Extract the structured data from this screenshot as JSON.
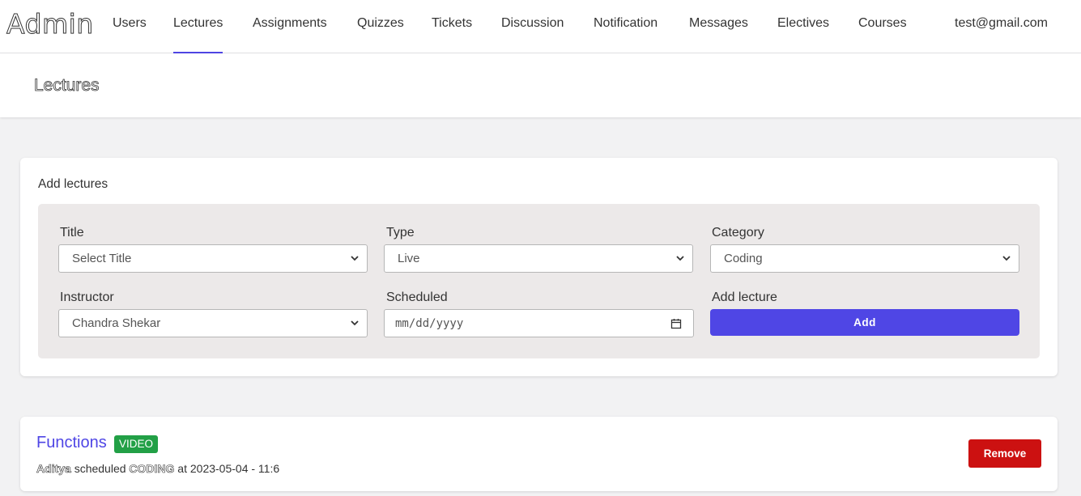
{
  "nav": {
    "brand": "Admin",
    "items": [
      "Users",
      "Lectures",
      "Assignments",
      "Quizzes",
      "Tickets",
      "Discussion",
      "Notification",
      "Messages",
      "Electives",
      "Courses"
    ],
    "active": "Lectures",
    "user_email": "test@gmail.com"
  },
  "page": {
    "title": "Lectures"
  },
  "add_form": {
    "card_title": "Add lectures",
    "title_label": "Title",
    "title_value": "Select Title",
    "type_label": "Type",
    "type_value": "Live",
    "category_label": "Category",
    "category_value": "Coding",
    "instructor_label": "Instructor",
    "instructor_value": "Chandra Shekar",
    "scheduled_label": "Scheduled",
    "scheduled_placeholder": "mm/dd/yyyy",
    "add_lecture_label": "Add lecture",
    "add_button": "Add"
  },
  "lectures": [
    {
      "title": "Functions",
      "type_badge": "VIDEO",
      "instructor": "Aditya",
      "scheduled_word": "scheduled",
      "category": "CODING",
      "at_word": "at",
      "datetime": "2023-05-04 - 11:6",
      "remove_label": "Remove"
    }
  ],
  "colors": {
    "accent": "#4f46e5",
    "badge_green": "#22a046",
    "remove_red": "#cc1111",
    "form_panel_bg": "#ece9e9"
  },
  "icons": {
    "select_chevron": "chevron-down-icon",
    "date_picker": "calendar-icon"
  }
}
